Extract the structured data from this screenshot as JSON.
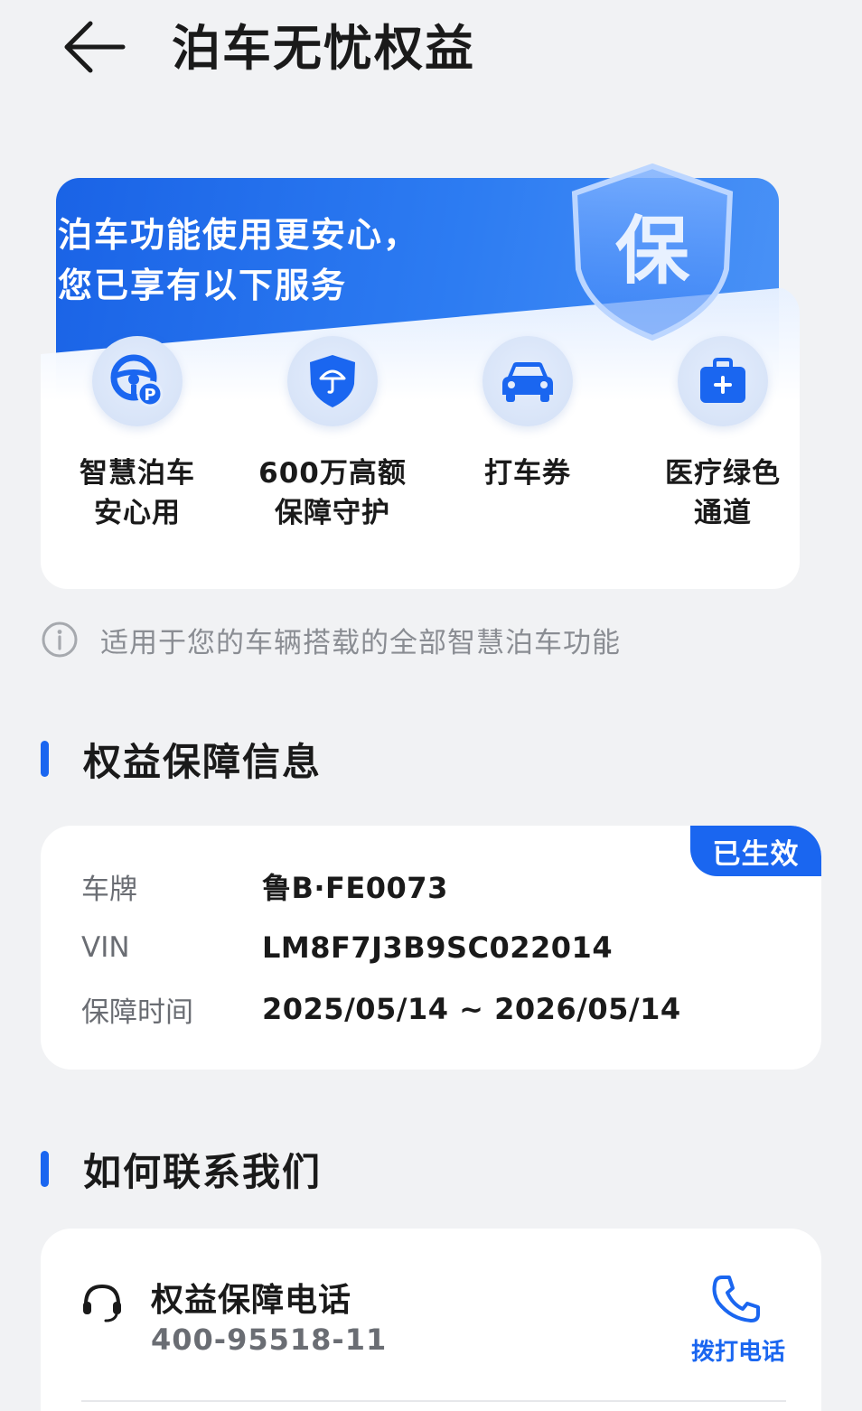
{
  "header": {
    "title": "泊车无忧权益"
  },
  "hero": {
    "line1": "泊车功能使用更安心，",
    "line2": "您已享有以下服务",
    "shield_char": "保",
    "services": [
      {
        "label": "智慧泊车\n安心用",
        "icon": "steering-wheel-parking-icon"
      },
      {
        "label": "600万高额\n保障守护",
        "icon": "umbrella-shield-icon"
      },
      {
        "label": "打车券",
        "icon": "car-icon"
      },
      {
        "label": "医疗绿色\n通道",
        "icon": "medical-kit-icon"
      }
    ]
  },
  "notice": {
    "text": "适用于您的车辆搭载的全部智慧泊车功能"
  },
  "sections": {
    "info_title": "权益保障信息",
    "contact_title": "如何联系我们"
  },
  "info": {
    "status": "已生效",
    "rows": [
      {
        "label": "车牌",
        "value": "鲁B·FE0073"
      },
      {
        "label": "VIN",
        "value": "LM8F7J3B9SC022014"
      },
      {
        "label": "保障时间",
        "value": "2025/05/14 ~ 2026/05/14"
      }
    ]
  },
  "contact": {
    "title": "权益保障电话",
    "number": "400-95518-11",
    "call_label": "拨打电话"
  },
  "colors": {
    "accent": "#1a66f0",
    "background": "#f1f2f4"
  }
}
